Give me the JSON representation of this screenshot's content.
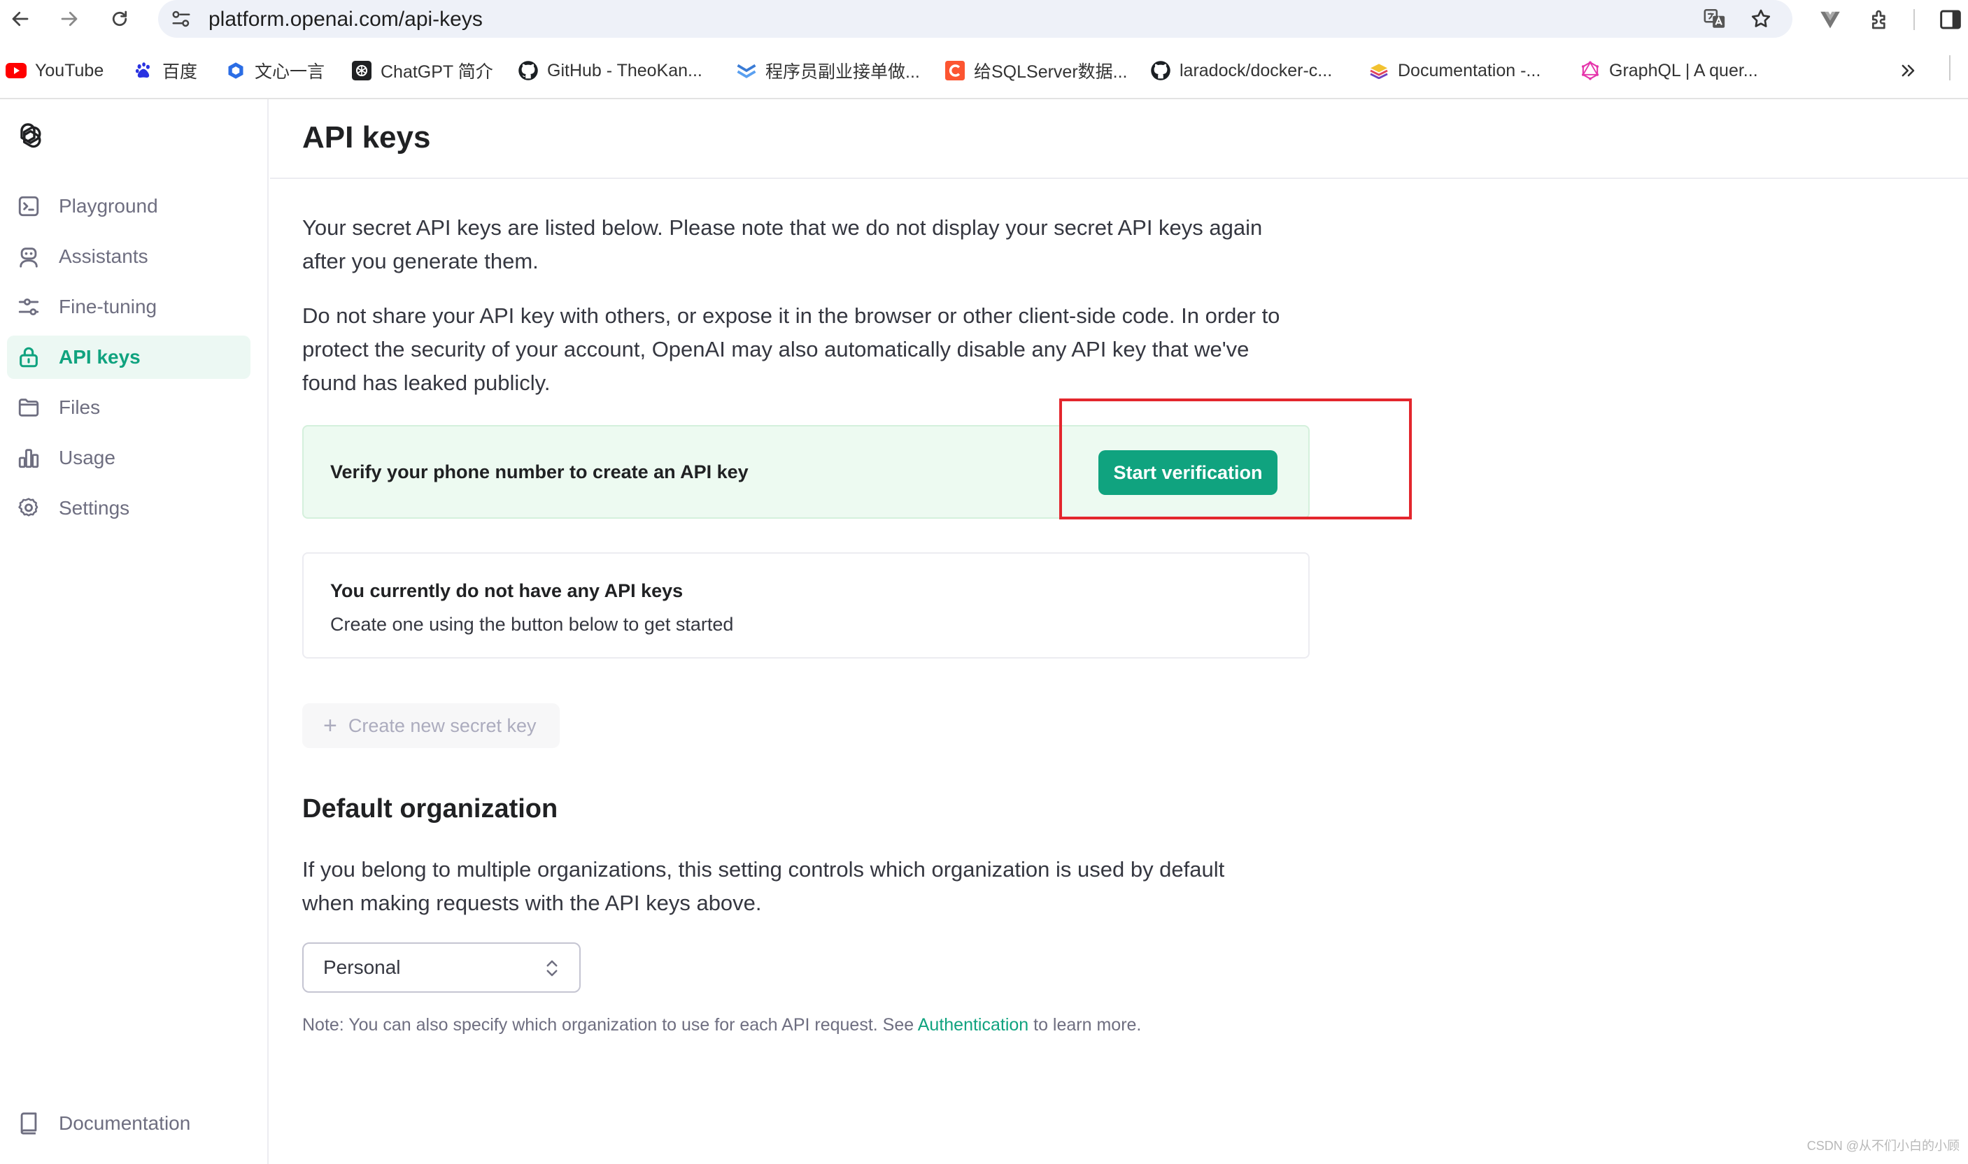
{
  "browser": {
    "url": "platform.openai.com/api-keys",
    "bookmarks": [
      {
        "label": "YouTube",
        "icon": "youtube-icon"
      },
      {
        "label": "百度",
        "icon": "baidu-icon"
      },
      {
        "label": "文心一言",
        "icon": "wenxin-icon"
      },
      {
        "label": "ChatGPT 简介",
        "icon": "openai-icon"
      },
      {
        "label": "GitHub - TheoKan...",
        "icon": "github-icon"
      },
      {
        "label": "程序员副业接单做...",
        "icon": "chevron-mark-icon"
      },
      {
        "label": "给SQLServer数据...",
        "icon": "csdn-icon"
      },
      {
        "label": "laradock/docker-c...",
        "icon": "github-icon"
      },
      {
        "label": "Documentation -...",
        "icon": "layers-icon"
      },
      {
        "label": "GraphQL | A quer...",
        "icon": "graphql-icon"
      }
    ]
  },
  "sidebar": {
    "items": [
      {
        "label": "Playground",
        "icon": "terminal-icon"
      },
      {
        "label": "Assistants",
        "icon": "robot-icon"
      },
      {
        "label": "Fine-tuning",
        "icon": "sliders-icon"
      },
      {
        "label": "API keys",
        "icon": "lock-icon",
        "active": true
      },
      {
        "label": "Files",
        "icon": "folder-icon"
      },
      {
        "label": "Usage",
        "icon": "bar-chart-icon"
      },
      {
        "label": "Settings",
        "icon": "gear-icon"
      }
    ],
    "footer": {
      "label": "Documentation",
      "icon": "book-icon"
    }
  },
  "main": {
    "title": "API keys",
    "intro_line1": "Your secret API keys are listed below. Please note that we do not display your secret API keys again",
    "intro_line2": "after you generate them.",
    "warning_line1": "Do not share your API key with others, or expose it in the browser or other client-side code. In order to",
    "warning_line2": "protect the security of your account, OpenAI may also automatically disable any API key that we've",
    "warning_line3": "found has leaked publicly.",
    "verify": {
      "text": "Verify your phone number to create an API key",
      "button": "Start verification"
    },
    "empty": {
      "title": "You currently do not have any API keys",
      "subtitle": "Create one using the button below to get started"
    },
    "create_button": "Create new secret key",
    "default_org": {
      "title": "Default organization",
      "desc_line1": "If you belong to multiple organizations, this setting controls which organization is used by default",
      "desc_line2": "when making requests with the API keys above.",
      "selected": "Personal",
      "note_prefix": "Note: You can also specify which organization to use for each API request. See ",
      "note_link": "Authentication",
      "note_suffix": " to learn more."
    }
  },
  "watermark": "CSDN @从不们小白的小顾",
  "colors": {
    "accent": "#10a37f",
    "highlight": "#e3262d",
    "verify_bg": "#edfaf1"
  }
}
